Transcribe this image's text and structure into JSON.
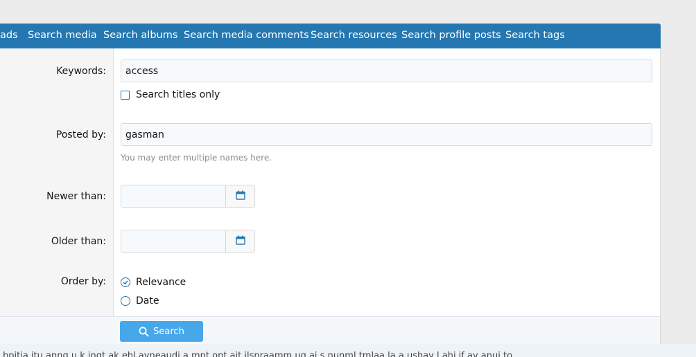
{
  "tabs": [
    {
      "label": "ads"
    },
    {
      "label": "Search media"
    },
    {
      "label": "Search albums"
    },
    {
      "label": "Search media comments"
    },
    {
      "label": "Search resources"
    },
    {
      "label": "Search profile posts"
    },
    {
      "label": "Search tags"
    }
  ],
  "form": {
    "keywords": {
      "label": "Keywords:",
      "value": "access"
    },
    "titles_only": {
      "label": "Search titles only",
      "checked": false
    },
    "posted_by": {
      "label": "Posted by:",
      "value": "gasman",
      "hint": "You may enter multiple names here."
    },
    "newer_than": {
      "label": "Newer than:",
      "value": ""
    },
    "older_than": {
      "label": "Older than:",
      "value": ""
    },
    "order_by": {
      "label": "Order by:",
      "options": [
        {
          "label": "Relevance",
          "selected": true
        },
        {
          "label": "Date",
          "selected": false
        }
      ]
    }
  },
  "submit": {
    "label": "Search"
  },
  "footer_text": "bpitia itu anng u k ingt ak ehl ayneaudi a mnt ont ait ilsnraamm ug ai s nunml tmlaa la a ushay l ahi if ay anui to",
  "colors": {
    "accent": "#2577b1",
    "button": "#47a7eb"
  }
}
